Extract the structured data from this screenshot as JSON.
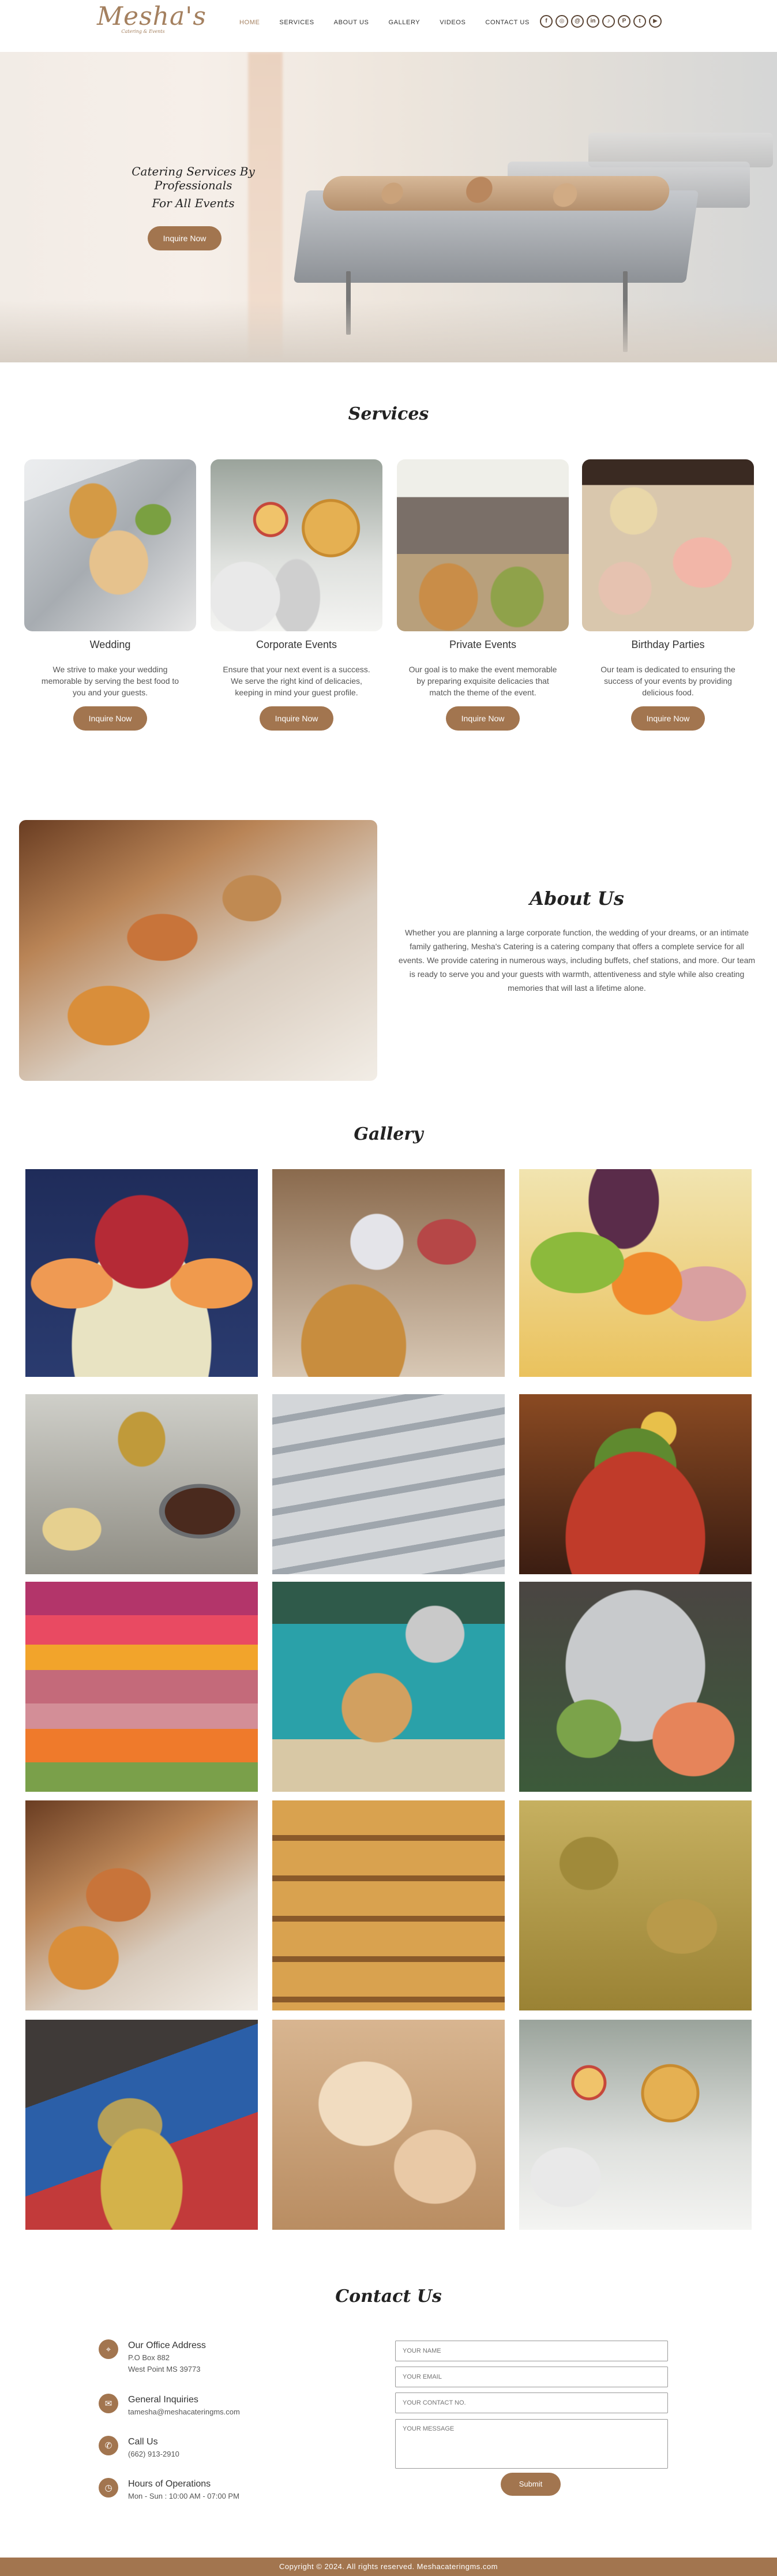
{
  "header": {
    "logo_text": "Mesha's",
    "logo_subtext": "Catering & Events",
    "nav": [
      "HOME",
      "SERVICES",
      "ABOUT US",
      "GALLERY",
      "VIDEOS",
      "CONTACT US"
    ],
    "social_icons": [
      "facebook-icon",
      "instagram-icon",
      "threads-icon",
      "linkedin-icon",
      "tiktok-icon",
      "pinterest-icon",
      "twitter-icon",
      "youtube-icon"
    ]
  },
  "hero": {
    "line1": "Catering Services By Professionals",
    "line2": "For All Events",
    "button": "Inquire Now"
  },
  "services": {
    "title": "Services",
    "cards": [
      {
        "title": "Wedding",
        "text": "We strive to make your wedding memorable by serving the best food to you and your guests.",
        "button": "Inquire Now"
      },
      {
        "title": "Corporate Events",
        "text": "Ensure that your next event is a success. We serve the right kind of delicacies, keeping in mind your guest profile.",
        "button": "Inquire Now"
      },
      {
        "title": "Private Events",
        "text": "Our goal is to make the event memorable by preparing exquisite delicacies that match the theme of the event.",
        "button": "Inquire Now"
      },
      {
        "title": "Birthday Parties",
        "text": "Our team is dedicated to ensuring the success of your events by providing delicious food.",
        "button": "Inquire Now"
      }
    ]
  },
  "about": {
    "title": "About Us",
    "text": "Whether you are planning a large corporate function, the wedding of your dreams, or an intimate family gathering, Mesha's Catering is a catering company that offers a complete service for all events. We provide catering in numerous ways, including buffets, chef stations, and more. Our team is ready to serve you and your guests with warmth, attentiveness and style while also creating memories that will last a lifetime alone."
  },
  "gallery": {
    "title": "Gallery"
  },
  "contact": {
    "title": "Contact Us",
    "items": [
      {
        "heading": "Our Office Address",
        "lines": [
          "P.O Box 882",
          "West Point MS 39773"
        ],
        "icon": "location-pin-icon"
      },
      {
        "heading": "General Inquiries",
        "lines": [
          "tamesha@meshacateringms.com"
        ],
        "icon": "envelope-icon"
      },
      {
        "heading": "Call Us",
        "lines": [
          "(662) 913-2910"
        ],
        "icon": "phone-icon"
      },
      {
        "heading": "Hours of Operations",
        "lines": [
          "Mon - Sun : 10:00 AM - 07:00 PM"
        ],
        "icon": "clock-icon"
      }
    ],
    "form": {
      "name_placeholder": "YOUR NAME",
      "email_placeholder": "YOUR EMAIL",
      "phone_placeholder": "YOUR CONTACT NO.",
      "message_placeholder": "YOUR MESSAGE",
      "submit": "Submit"
    }
  },
  "footer": {
    "text": "Copyright © 2024. All rights reserved. Meshacateringms.com"
  },
  "colors": {
    "accent": "#a2754f",
    "logo": "#a4805f",
    "footer": "#a2754f"
  }
}
